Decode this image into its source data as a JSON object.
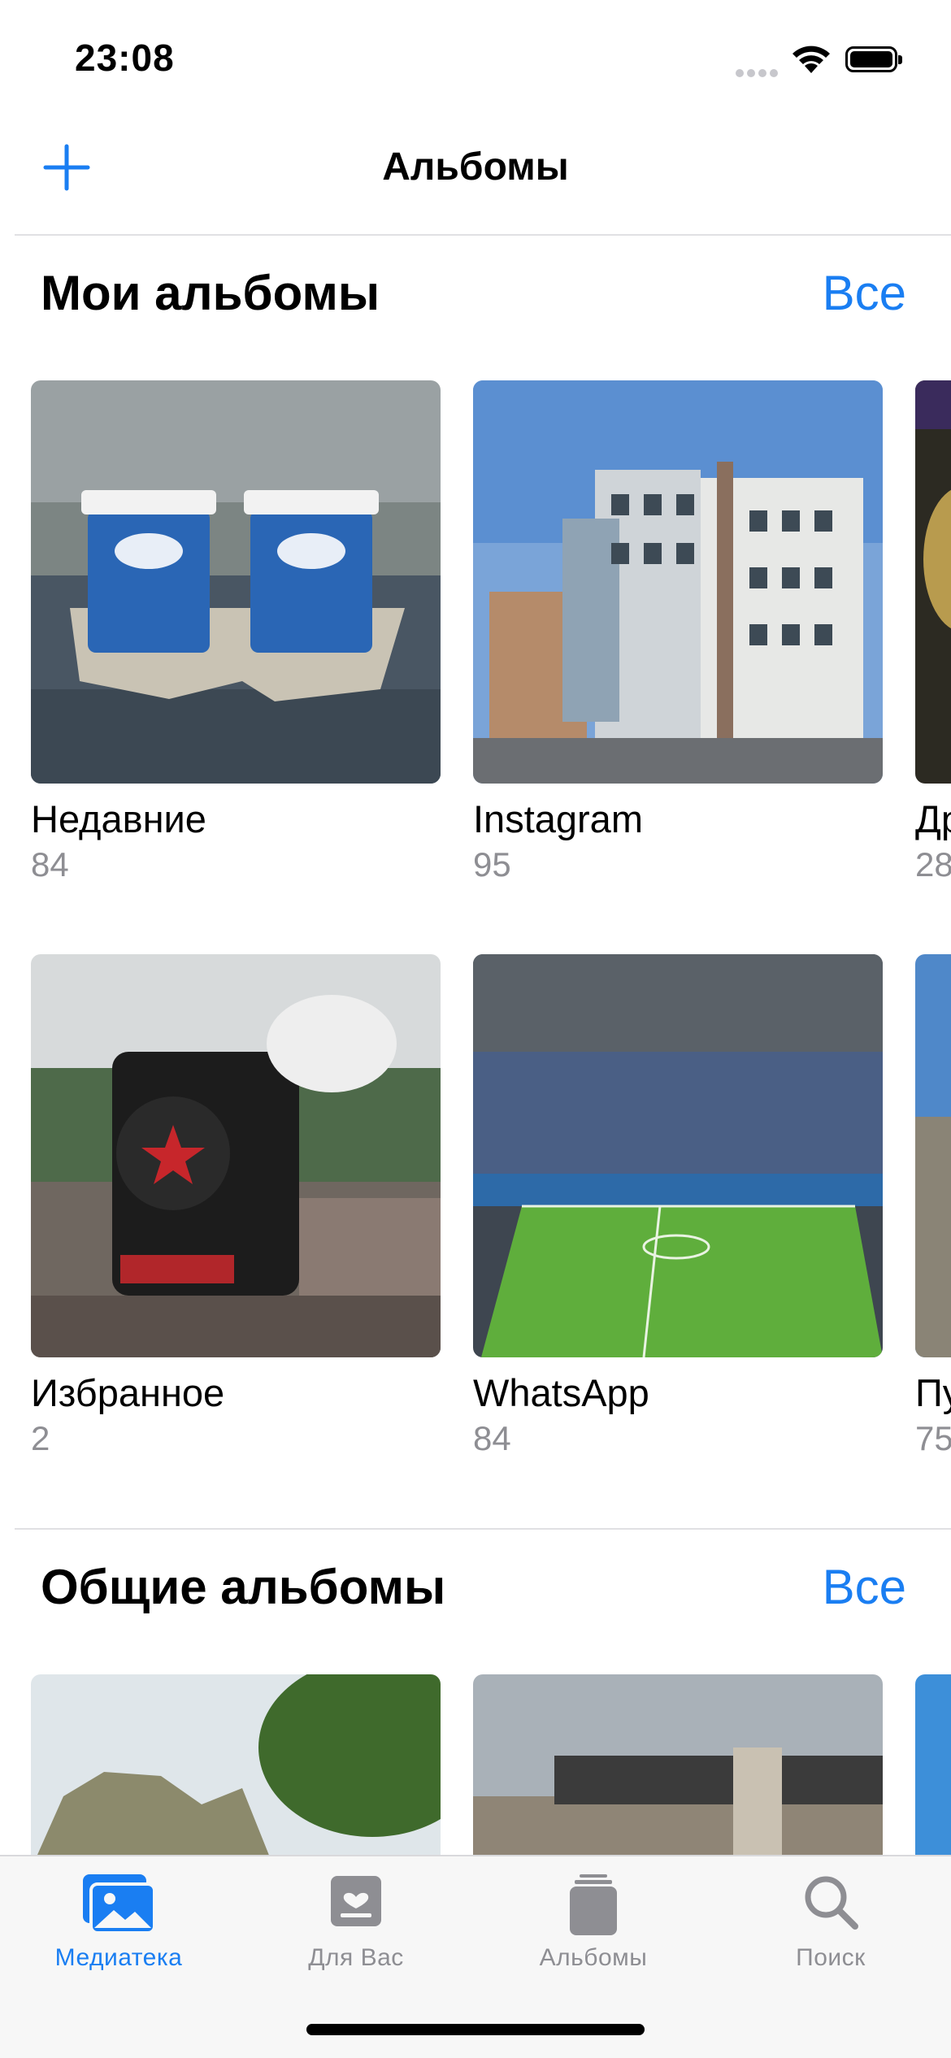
{
  "status_bar": {
    "time": "23:08"
  },
  "nav": {
    "title": "Альбомы",
    "add_icon": "plus-icon"
  },
  "my_albums": {
    "title": "Мои альбомы",
    "see_all": "Все",
    "albums": [
      {
        "name": "Недавние",
        "count": "84"
      },
      {
        "name": "Instagram",
        "count": "95"
      },
      {
        "name": "Др",
        "count": "28"
      },
      {
        "name": "Избранное",
        "count": "2"
      },
      {
        "name": "WhatsApp",
        "count": "84"
      },
      {
        "name": "Пу",
        "count": "75"
      }
    ]
  },
  "shared_albums": {
    "title": "Общие альбомы",
    "see_all": "Все"
  },
  "tab_bar": {
    "tabs": [
      {
        "label": "Медиатека",
        "icon": "photo-library-icon",
        "active": true
      },
      {
        "label": "Для Вас",
        "icon": "for-you-icon",
        "active": false
      },
      {
        "label": "Альбомы",
        "icon": "albums-stack-icon",
        "active": false
      },
      {
        "label": "Поиск",
        "icon": "search-icon",
        "active": false
      }
    ]
  },
  "colors": {
    "accent": "#1a7ef2",
    "secondary_text": "#8e8e93"
  }
}
